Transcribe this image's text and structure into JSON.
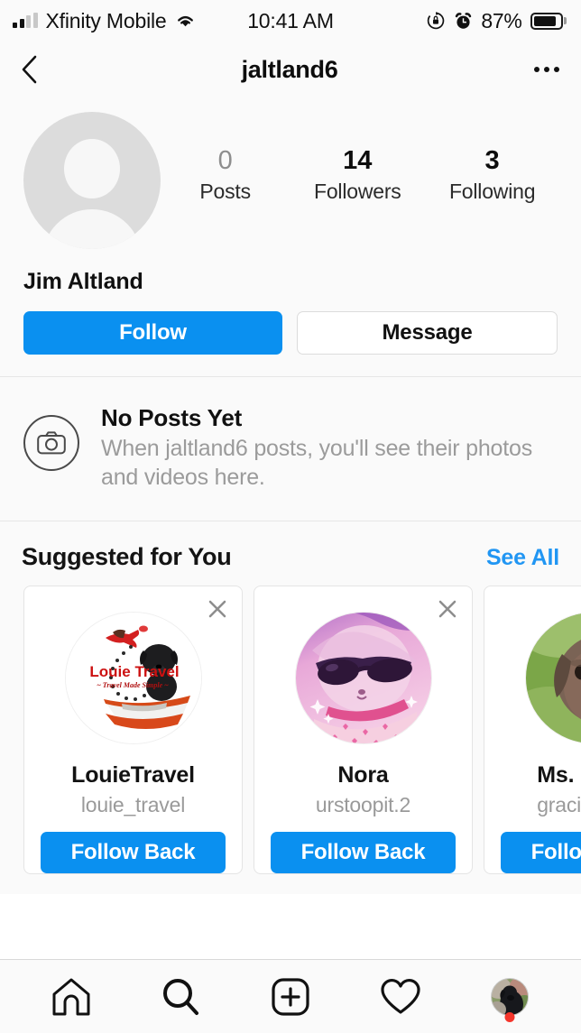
{
  "status_bar": {
    "carrier": "Xfinity Mobile",
    "time": "10:41 AM",
    "battery_percent": "87%",
    "signal_icon": "signal-bars-icon",
    "wifi_icon": "wifi-icon",
    "rotation_lock_icon": "rotation-lock-icon",
    "alarm_icon": "alarm-clock-icon",
    "battery_icon": "battery-icon"
  },
  "header": {
    "back_icon": "back-chevron-icon",
    "title": "jaltland6",
    "more_icon": "more-options-icon"
  },
  "profile": {
    "avatar_icon": "default-avatar-icon",
    "full_name": "Jim Altland",
    "stats": [
      {
        "value": "0",
        "label": "Posts",
        "zero": true
      },
      {
        "value": "14",
        "label": "Followers",
        "zero": false
      },
      {
        "value": "3",
        "label": "Following",
        "zero": false
      }
    ],
    "follow_label": "Follow",
    "message_label": "Message"
  },
  "no_posts": {
    "icon": "camera-icon",
    "title": "No Posts Yet",
    "subtitle": "When jaltland6 posts, you'll see their photos and videos here."
  },
  "suggested": {
    "title": "Suggested for You",
    "see_all_label": "See All",
    "cards": [
      {
        "name": "LouieTravel",
        "username": "louie_travel",
        "button_label": "Follow Back",
        "avatar": "louie-travel-logo-photo",
        "close_icon": "dismiss-icon"
      },
      {
        "name": "Nora",
        "username": "urstoopit.2",
        "button_label": "Follow Back",
        "avatar": "nora-sunglasses-photo",
        "close_icon": "dismiss-icon"
      },
      {
        "name": "Ms. Gracie",
        "username": "gracieofficial",
        "button_label": "Follow Back",
        "avatar": "gracie-puppy-photo",
        "close_icon": "dismiss-icon"
      }
    ]
  },
  "tabbar": {
    "items": [
      {
        "icon": "home-icon"
      },
      {
        "icon": "search-icon"
      },
      {
        "icon": "add-post-icon"
      },
      {
        "icon": "activity-heart-icon"
      },
      {
        "icon": "profile-avatar-icon"
      }
    ]
  },
  "colors": {
    "accent_blue": "#0a90f0",
    "link_blue": "#2196f3",
    "notification_red": "#f5352b",
    "muted_gray": "#9a9a9a",
    "page_bg": "#fafafa"
  }
}
